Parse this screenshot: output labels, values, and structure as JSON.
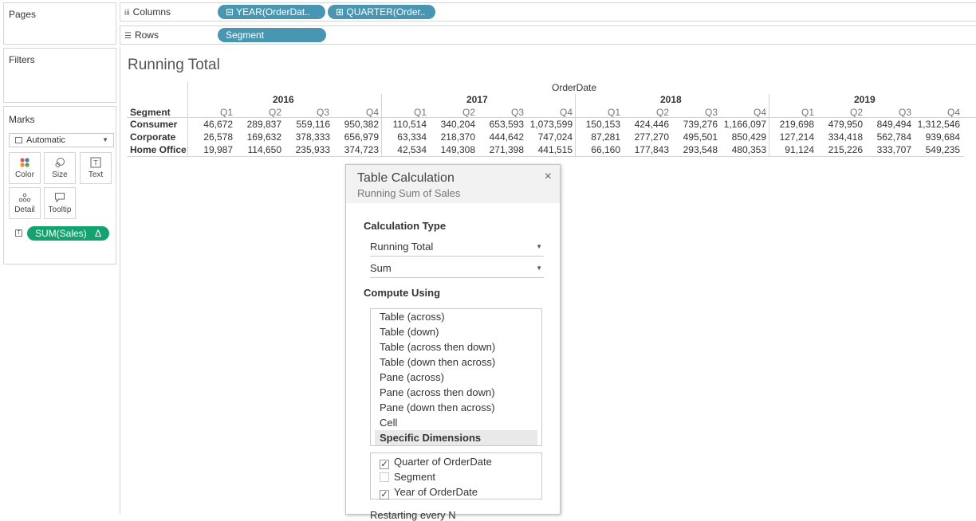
{
  "panels": {
    "pages": "Pages",
    "filters": "Filters",
    "marks": "Marks"
  },
  "marks": {
    "type": "Automatic",
    "buttons": {
      "color": "Color",
      "size": "Size",
      "text": "Text",
      "detail": "Detail",
      "tooltip": "Tooltip"
    },
    "pill": "SUM(Sales)",
    "pill_delta": "Δ"
  },
  "shelves": {
    "columns_label": "Columns",
    "rows_label": "Rows",
    "columns_pills": [
      "⊟ YEAR(OrderDat..",
      "⊞ QUARTER(Order.."
    ],
    "rows_pills": [
      "Segment"
    ]
  },
  "view": {
    "title": "Running Total",
    "column_header": "OrderDate",
    "row_header": "Segment",
    "years": [
      "2016",
      "2017",
      "2018",
      "2019"
    ],
    "quarters": [
      "Q1",
      "Q2",
      "Q3",
      "Q4"
    ],
    "rows": [
      {
        "segment": "Consumer",
        "values": [
          "46,672",
          "289,837",
          "559,116",
          "950,382",
          "110,514",
          "340,204",
          "653,593",
          "1,073,599",
          "150,153",
          "424,446",
          "739,276",
          "1,166,097",
          "219,698",
          "479,950",
          "849,494",
          "1,312,546"
        ]
      },
      {
        "segment": "Corporate",
        "values": [
          "26,578",
          "169,632",
          "378,333",
          "656,979",
          "63,334",
          "218,370",
          "444,642",
          "747,024",
          "87,281",
          "277,270",
          "495,501",
          "850,429",
          "127,214",
          "334,418",
          "562,784",
          "939,684"
        ]
      },
      {
        "segment": "Home Office",
        "values": [
          "19,987",
          "114,650",
          "235,933",
          "374,723",
          "42,534",
          "149,308",
          "271,398",
          "441,515",
          "66,160",
          "177,843",
          "293,548",
          "480,353",
          "91,124",
          "215,226",
          "333,707",
          "549,235"
        ]
      }
    ]
  },
  "dialog": {
    "title": "Table Calculation",
    "subtitle": "Running Sum of Sales",
    "calc_type_label": "Calculation Type",
    "calc_type": "Running Total",
    "aggregation": "Sum",
    "compute_label": "Compute Using",
    "compute_options": [
      "Table (across)",
      "Table (down)",
      "Table (across then down)",
      "Table (down then across)",
      "Pane (across)",
      "Pane (across then down)",
      "Pane (down then across)",
      "Cell",
      "Specific Dimensions"
    ],
    "selected_option": "Specific Dimensions",
    "dimensions": [
      {
        "label": "Quarter of OrderDate",
        "checked": true
      },
      {
        "label": "Segment",
        "checked": false
      },
      {
        "label": "Year of OrderDate",
        "checked": true
      }
    ],
    "partial_text": "Restarting every  N"
  }
}
